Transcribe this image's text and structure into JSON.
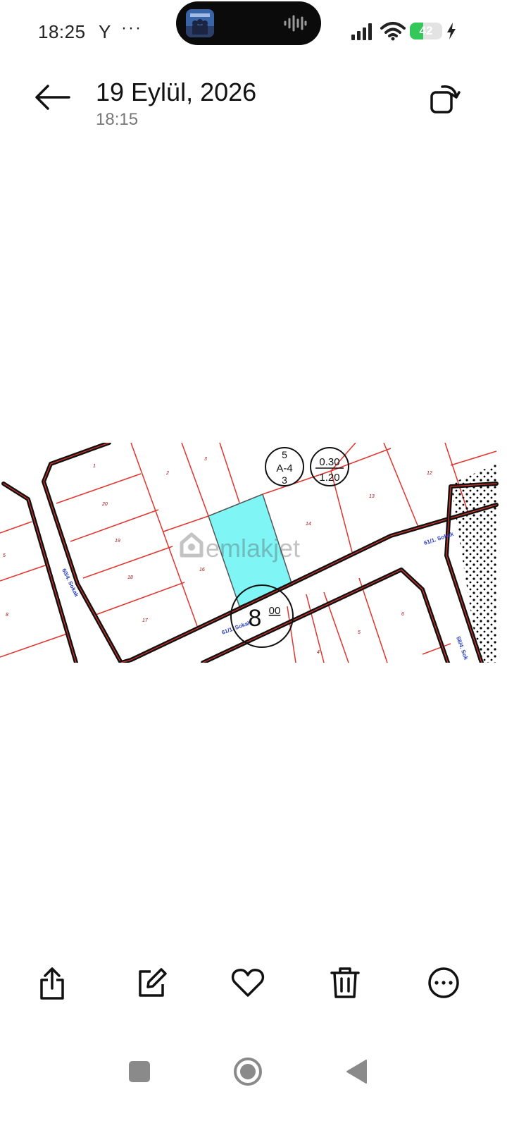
{
  "status_bar": {
    "time": "18:25",
    "carrier_glyph": "Y",
    "more_glyph": "···",
    "battery_level": "42",
    "battery_fraction": 0.42,
    "signal_icon": "signal-bars-icon",
    "wifi_icon": "wifi-icon",
    "charging_icon": "charging-bolt-icon"
  },
  "header": {
    "date": "19 Eylül, 2026",
    "time": "18:15",
    "back_icon": "arrow-left-icon",
    "rotate_icon": "rotate-icon"
  },
  "photo": {
    "watermark": "emlakjet",
    "zone_code": {
      "top": "5",
      "middle": "A-4",
      "bottom": "3"
    },
    "ratios": {
      "top": "0.30",
      "bottom": "1.20"
    },
    "road_width": {
      "main": "8",
      "sub": "00"
    },
    "streets": [
      "61/1. Sokak",
      "60/4. Sokak",
      "61/1. Sokak",
      "58/4. Sok"
    ],
    "parcel_numbers": [
      "1",
      "2",
      "3",
      "20",
      "19",
      "18",
      "17",
      "16",
      "14",
      "13",
      "12",
      "5",
      "6",
      "4",
      "5",
      "8"
    ],
    "highlight_color": "#7ff5f5",
    "line_color": "#e0342c"
  },
  "toolbar": {
    "items": [
      "share-icon",
      "edit-icon",
      "favorite-icon",
      "delete-icon",
      "more-icon"
    ]
  },
  "navbar": {
    "items": [
      "recents-button",
      "home-button",
      "back-button"
    ]
  }
}
